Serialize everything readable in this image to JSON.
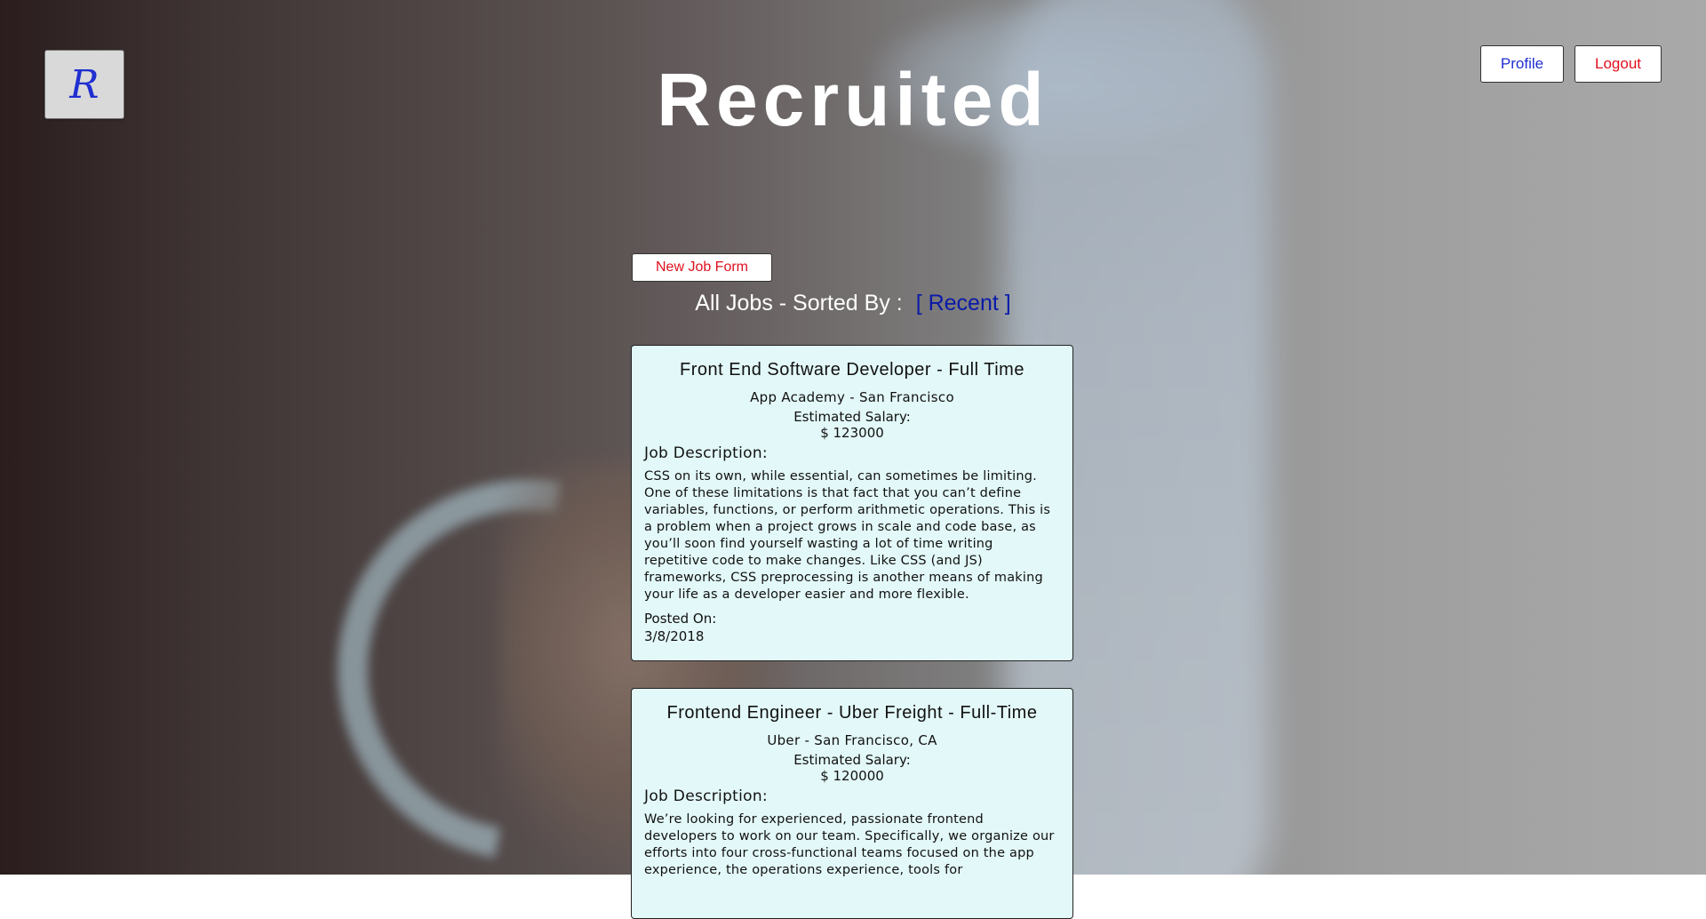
{
  "app": {
    "logo_letter": "R",
    "title": "Recruited"
  },
  "nav": {
    "profile_label": "Profile",
    "logout_label": "Logout"
  },
  "actions": {
    "new_job_label": "New Job Form"
  },
  "sort": {
    "heading": "All Jobs - Sorted By :",
    "current": "[ Recent ]"
  },
  "colors": {
    "accent_blue": "#1f2fd0",
    "accent_red": "#e0101e",
    "card_bg": "#e3f8f8"
  },
  "jobs": [
    {
      "title": "Front End Software Developer - Full Time",
      "company": "App Academy - San Francisco",
      "salary_label": "Estimated Salary:",
      "salary": "$ 123000",
      "description_label": "Job Description:",
      "description": "CSS on its own, while essential, can sometimes be limiting. One of these limitations is that fact that you can’t define variables, functions, or perform arithmetic operations. This is a problem when a project grows in scale and code base, as you’ll soon find yourself wasting a lot of time writing repetitive code to make changes. Like CSS (and JS) frameworks, CSS preprocessing is another means of making your life as a developer easier and more flexible.",
      "posted_label": "Posted On:",
      "posted": "3/8/2018"
    },
    {
      "title": "Frontend Engineer - Uber Freight - Full-Time",
      "company": "Uber - San Francisco, CA",
      "salary_label": "Estimated Salary:",
      "salary": "$ 120000",
      "description_label": "Job Description:",
      "description": "We’re looking for experienced, passionate frontend developers to work on our team. Specifically, we organize our efforts into four cross-functional teams focused on the app experience, the operations experience, tools for",
      "posted_label": "",
      "posted": ""
    }
  ]
}
